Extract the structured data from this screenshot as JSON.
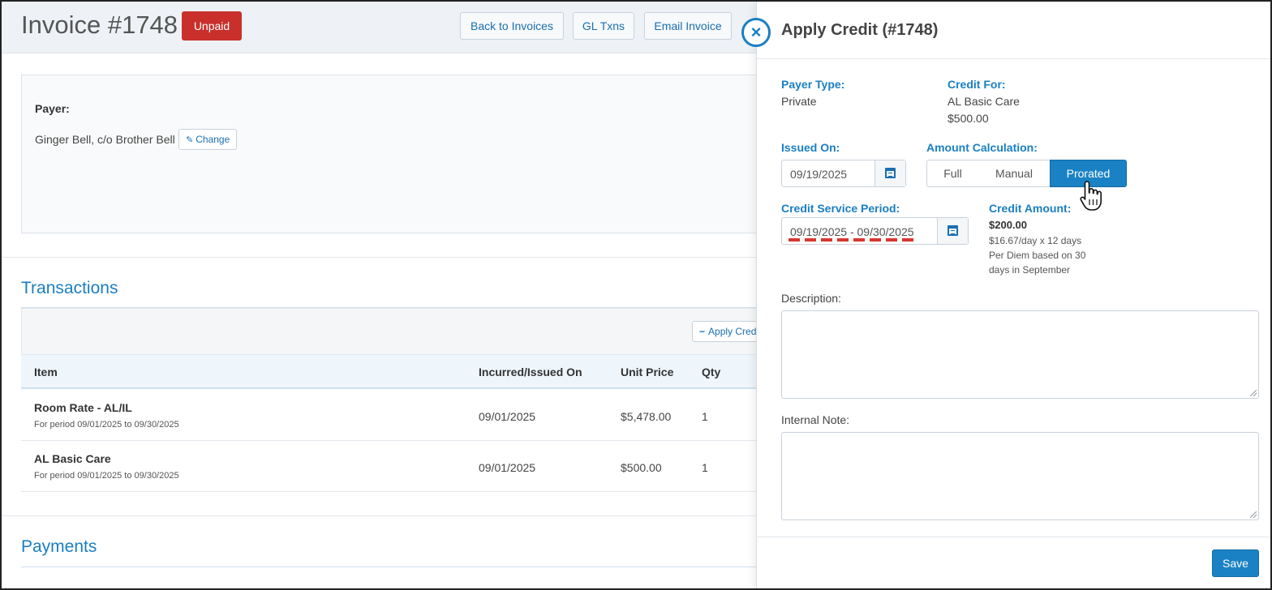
{
  "invoice": {
    "title": "Invoice #1748",
    "status": "Unpaid",
    "buttons": {
      "back": "Back to Invoices",
      "gl": "GL Txns",
      "email": "Email Invoice"
    }
  },
  "payer": {
    "label": "Payer:",
    "name": "Ginger Bell, c/o Brother Bell",
    "change_label": "Change"
  },
  "transactions": {
    "title": "Transactions",
    "apply_credit_label": "Apply Credit",
    "columns": [
      "Item",
      "Incurred/Issued On",
      "Unit Price",
      "Qty"
    ],
    "rows": [
      {
        "item": "Room Rate - AL/IL",
        "period": "For period 09/01/2025 to 09/30/2025",
        "date": "09/01/2025",
        "price": "$5,478.00",
        "qty": "1"
      },
      {
        "item": "AL Basic Care",
        "period": "For period 09/01/2025 to 09/30/2025",
        "date": "09/01/2025",
        "price": "$500.00",
        "qty": "1"
      }
    ]
  },
  "payments": {
    "title": "Payments"
  },
  "modal": {
    "title": "Apply Credit (#1748)",
    "payer_type_label": "Payer Type:",
    "payer_type_value": "Private",
    "credit_for_label": "Credit For:",
    "credit_for_item": "AL Basic Care",
    "credit_for_amount": "$500.00",
    "issued_on_label": "Issued On:",
    "issued_on_value": "09/19/2025",
    "amount_calc_label": "Amount Calculation:",
    "amount_calc_options": [
      "Full",
      "Manual",
      "Prorated"
    ],
    "amount_calc_selected": "Prorated",
    "service_period_label": "Credit Service Period:",
    "service_period_value": "09/19/2025 - 09/30/2025",
    "credit_amount_label": "Credit Amount:",
    "credit_amount_value": "$200.00",
    "credit_amount_detail1": "$16.67/day x 12 days",
    "credit_amount_detail2": "Per Diem based on 30",
    "credit_amount_detail3": "days in September",
    "description_label": "Description:",
    "internal_note_label": "Internal Note:",
    "save_label": "Save"
  },
  "colors": {
    "accent": "#1a82c4",
    "danger": "#c9302c",
    "heading": "#1a7fc1"
  }
}
